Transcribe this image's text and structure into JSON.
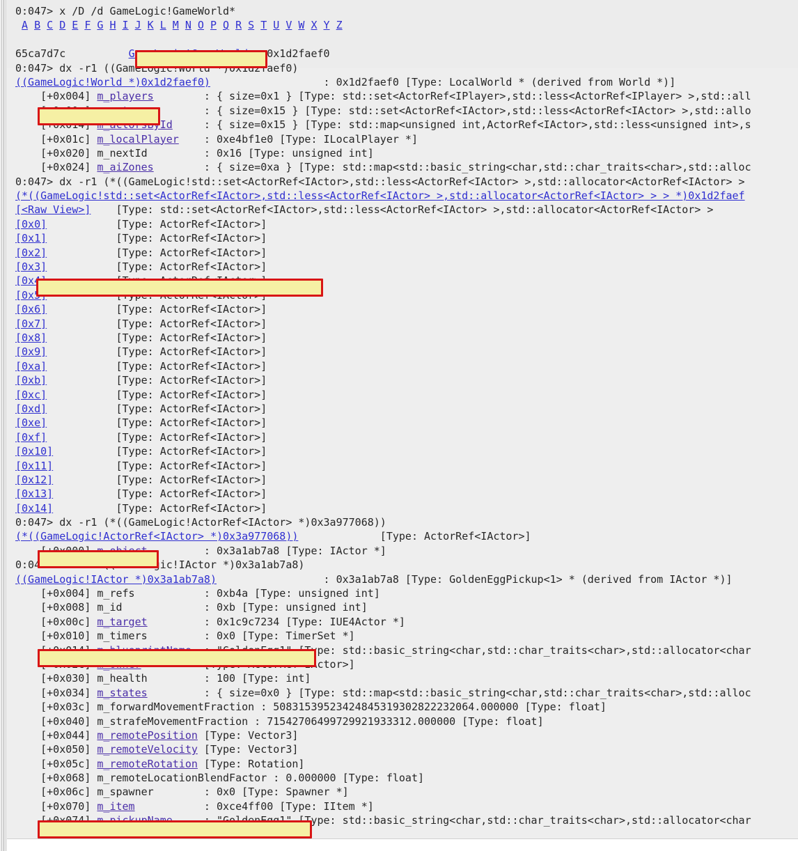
{
  "window": {
    "title": "WinDbg debugger output",
    "background_color": "#eeeeee",
    "header_background_color": "#ececec",
    "link_color": "#2f2fd0",
    "highlight_color": "#f5f0a0",
    "annotation_box_color": "#d81515"
  },
  "alphabet_bar": {
    "letters": [
      "A",
      "B",
      "C",
      "D",
      "E",
      "F",
      "G",
      "H",
      "I",
      "J",
      "K",
      "L",
      "M",
      "N",
      "O",
      "P",
      "Q",
      "R",
      "S",
      "T",
      "U",
      "V",
      "W",
      "X",
      "Y",
      "Z"
    ]
  },
  "lines": [
    {
      "id": "l00",
      "text": "0:047> x /D /d GameLogic!GameWorld*"
    },
    {
      "id": "l01",
      "text": "alphabet"
    },
    {
      "id": "l02",
      "text": ""
    },
    {
      "id": "l03",
      "prefix": "65ca7d7c          ",
      "link": "GameLogic!GameWorld",
      "suffix": " = 0x1d2faef0"
    },
    {
      "id": "l04",
      "text": "0:047> dx -r1 ((GameLogic!World *)0x1d2faef0)"
    },
    {
      "id": "l05",
      "link": "((GameLogic!World *)0x1d2faef0)",
      "suffix": "                  : 0x1d2faef0 [Type: LocalWorld * (derived from World *)]"
    },
    {
      "id": "l06",
      "offset": "    [+0x004] ",
      "member": "m_players",
      "rest": "        : { size=0x1 } [Type: std::set<ActorRef<IPlayer>,std::less<ActorRef<IPlayer> >,std::all"
    },
    {
      "id": "l07",
      "offset": "    [+0x00c] ",
      "member": "m_actors",
      "rest": "         : { size=0x15 } [Type: std::set<ActorRef<IActor>,std::less<ActorRef<IActor> >,std::allo"
    },
    {
      "id": "l08",
      "offset": "    [+0x014] ",
      "member": "m_actorsById",
      "rest": "     : { size=0x15 } [Type: std::map<unsigned int,ActorRef<IActor>,std::less<unsigned int>,s"
    },
    {
      "id": "l09",
      "offset": "    [+0x01c] ",
      "member": "m_localPlayer",
      "rest": "    : 0xe4bf1e0 [Type: ILocalPlayer *]"
    },
    {
      "id": "l10",
      "offset": "    [+0x020] ",
      "member_plain": "m_nextId",
      "rest": "         : 0x16 [Type: unsigned int]"
    },
    {
      "id": "l11",
      "offset": "    [+0x024] ",
      "member": "m_aiZones",
      "rest": "        : { size=0xa } [Type: std::map<std::basic_string<char,std::char_traits<char>,std::alloc"
    },
    {
      "id": "l12",
      "text": "0:047> dx -r1 (*((GameLogic!std::set<ActorRef<IActor>,std::less<ActorRef<IActor> >,std::allocator<ActorRef<IActor> >"
    },
    {
      "id": "l13",
      "link": "(*((GameLogic!std::set<ActorRef<IActor>,std::less<ActorRef<IActor> >,std::allocator<ActorRef<IActor> > > *)0x1d2faef"
    },
    {
      "id": "l14",
      "bracket": "[<Raw View>]",
      "rest": "    [Type: std::set<ActorRef<IActor>,std::less<ActorRef<IActor> >,std::allocator<ActorRef<IActor> > "
    },
    {
      "id": "l15",
      "bracket": "[0x0]",
      "rest": "           [Type: ActorRef<IActor>]"
    },
    {
      "id": "l16",
      "bracket": "[0x1]",
      "rest": "           [Type: ActorRef<IActor>]"
    },
    {
      "id": "l17",
      "bracket": "[0x2]",
      "rest": "           [Type: ActorRef<IActor>]"
    },
    {
      "id": "l18",
      "bracket": "[0x3]",
      "rest": "           [Type: ActorRef<IActor>]"
    },
    {
      "id": "l19",
      "bracket": "[0x4]",
      "rest": "           [Type: ActorRef<IActor>]"
    },
    {
      "id": "l20",
      "bracket": "[0x5]",
      "rest": "           [Type: ActorRef<IActor>]"
    },
    {
      "id": "l21",
      "bracket": "[0x6]",
      "rest": "           [Type: ActorRef<IActor>]"
    },
    {
      "id": "l22",
      "bracket": "[0x7]",
      "rest": "           [Type: ActorRef<IActor>]"
    },
    {
      "id": "l23",
      "bracket": "[0x8]",
      "rest": "           [Type: ActorRef<IActor>]"
    },
    {
      "id": "l24",
      "bracket": "[0x9]",
      "rest": "           [Type: ActorRef<IActor>]"
    },
    {
      "id": "l25",
      "bracket": "[0xa]",
      "rest": "           [Type: ActorRef<IActor>]"
    },
    {
      "id": "l26",
      "bracket": "[0xb]",
      "rest": "           [Type: ActorRef<IActor>]"
    },
    {
      "id": "l27",
      "bracket": "[0xc]",
      "rest": "           [Type: ActorRef<IActor>]"
    },
    {
      "id": "l28",
      "bracket": "[0xd]",
      "rest": "           [Type: ActorRef<IActor>]"
    },
    {
      "id": "l29",
      "bracket": "[0xe]",
      "rest": "           [Type: ActorRef<IActor>]"
    },
    {
      "id": "l30",
      "bracket": "[0xf]",
      "rest": "           [Type: ActorRef<IActor>]"
    },
    {
      "id": "l31",
      "bracket": "[0x10]",
      "rest": "          [Type: ActorRef<IActor>]"
    },
    {
      "id": "l32",
      "bracket": "[0x11]",
      "rest": "          [Type: ActorRef<IActor>]"
    },
    {
      "id": "l33",
      "bracket": "[0x12]",
      "rest": "          [Type: ActorRef<IActor>]"
    },
    {
      "id": "l34",
      "bracket": "[0x13]",
      "rest": "          [Type: ActorRef<IActor>]"
    },
    {
      "id": "l35",
      "bracket": "[0x14]",
      "rest": "          [Type: ActorRef<IActor>]"
    },
    {
      "id": "l36",
      "text": "0:047> dx -r1 (*((GameLogic!ActorRef<IActor> *)0x3a977068))"
    },
    {
      "id": "l37",
      "link": "(*((GameLogic!ActorRef<IActor> *)0x3a977068))",
      "suffix": "             [Type: ActorRef<IActor>]"
    },
    {
      "id": "l38",
      "offset": "    [+0x000] ",
      "member": "m_object",
      "rest": "         : 0x3a1ab7a8 [Type: IActor *]"
    },
    {
      "id": "l39",
      "text": "0:047> dx -r1 ((GameLogic!IActor *)0x3a1ab7a8)"
    },
    {
      "id": "l40",
      "link": "((GameLogic!IActor *)0x3a1ab7a8)",
      "suffix": "                 : 0x3a1ab7a8 [Type: GoldenEggPickup<1> * (derived from IActor *)]"
    },
    {
      "id": "l41",
      "offset": "    [+0x004] ",
      "member_plain": "m_refs",
      "rest": "           : 0xb4a [Type: unsigned int]"
    },
    {
      "id": "l42",
      "offset": "    [+0x008] ",
      "member_plain": "m_id",
      "rest": "             : 0xb [Type: unsigned int]"
    },
    {
      "id": "l43",
      "offset": "    [+0x00c] ",
      "member": "m_target",
      "rest": "         : 0x1c9c7234 [Type: IUE4Actor *]"
    },
    {
      "id": "l44",
      "offset": "    [+0x010] ",
      "member_plain": "m_timers",
      "rest": "         : 0x0 [Type: TimerSet *]"
    },
    {
      "id": "l45",
      "offset": "    [+0x014] ",
      "member": "m_blueprintName",
      "rest": "  : \"GoldenEgg1\" [Type: std::basic_string<char,std::char_traits<char>,std::allocator<char"
    },
    {
      "id": "l46",
      "offset": "    [+0x02c] ",
      "member": "m_owner",
      "rest": "          [Type: ActorRef<IActor>]"
    },
    {
      "id": "l47",
      "offset": "    [+0x030] ",
      "member_plain": "m_health",
      "rest": "         : 100 [Type: int]"
    },
    {
      "id": "l48",
      "offset": "    [+0x034] ",
      "member": "m_states",
      "rest": "         : { size=0x0 } [Type: std::map<std::basic_string<char,std::char_traits<char>,std::alloc"
    },
    {
      "id": "l49",
      "offset": "    [+0x03c] ",
      "member_plain": "m_forwardMovementFraction",
      "rest": " : 50831539523424845319302822232064.000000 [Type: float]"
    },
    {
      "id": "l50",
      "offset": "    [+0x040] ",
      "member_plain": "m_strafeMovementFraction",
      "rest": " : 71542706499729921933312.000000 [Type: float]"
    },
    {
      "id": "l51",
      "offset": "    [+0x044] ",
      "member": "m_remotePosition",
      "rest": " [Type: Vector3]"
    },
    {
      "id": "l52",
      "offset": "    [+0x050] ",
      "member": "m_remoteVelocity",
      "rest": " [Type: Vector3]"
    },
    {
      "id": "l53",
      "offset": "    [+0x05c] ",
      "member": "m_remoteRotation",
      "rest": " [Type: Rotation]"
    },
    {
      "id": "l54",
      "offset": "    [+0x068] ",
      "member_plain": "m_remoteLocationBlendFactor",
      "rest": " : 0.000000 [Type: float]"
    },
    {
      "id": "l55",
      "offset": "    [+0x06c] ",
      "member_plain": "m_spawner",
      "rest": "        : 0x0 [Type: Spawner *]"
    },
    {
      "id": "l56",
      "offset": "    [+0x070] ",
      "member": "m_item",
      "rest": "           : 0xce4ff00 [Type: IItem *]"
    },
    {
      "id": "l57",
      "offset": "    [+0x074] ",
      "member": "m_pickupName",
      "rest": "     : \"GoldenEgg1\" [Type: std::basic_string<char,std::char_traits<char>,std::allocator<char"
    }
  ],
  "annotations": [
    {
      "name": "gameworld-symbol",
      "label": "GameLogic!GameWorld",
      "line": "l03"
    },
    {
      "name": "m-actors-member",
      "label": "[+0x00c] m_actors",
      "line": "l07"
    },
    {
      "name": "actor-index-4",
      "label": "[0x4]  [Type: ActorRef<IActor>]",
      "line": "l19"
    },
    {
      "name": "m-object-member",
      "label": "[+0x000] m_object",
      "line": "l38"
    },
    {
      "name": "m-blueprintname-member",
      "label": "[+0x014] m_blueprintName : \"GoldenEgg1\"",
      "line": "l45"
    },
    {
      "name": "m-pickupname-member",
      "label": "[+0x074] m_pickupName : \"GoldenEgg1\"",
      "line": "l57"
    }
  ]
}
